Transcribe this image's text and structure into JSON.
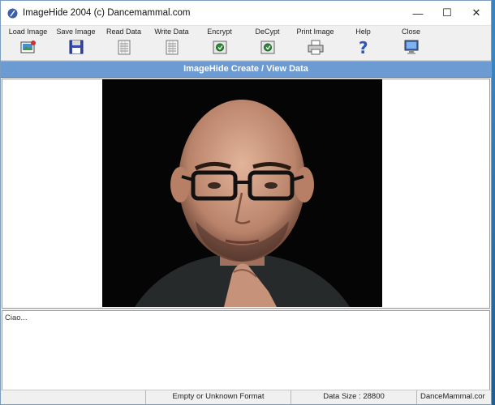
{
  "window": {
    "title": "ImageHide 2004 (c) Dancemammal.com",
    "minimize": "—",
    "maximize": "☐",
    "close": "✕"
  },
  "toolbar": [
    {
      "label": "Load Image",
      "icon": "load-image-icon"
    },
    {
      "label": "Save Image",
      "icon": "floppy-disk-icon"
    },
    {
      "label": "Read Data",
      "icon": "read-data-icon"
    },
    {
      "label": "Write Data",
      "icon": "write-data-icon"
    },
    {
      "label": "Encrypt",
      "icon": "encrypt-icon"
    },
    {
      "label": "DeCypt",
      "icon": "decrypt-icon"
    },
    {
      "label": "Print Image",
      "icon": "printer-icon"
    },
    {
      "label": "Help",
      "icon": "help-icon"
    },
    {
      "label": "Close",
      "icon": "close-monitor-icon"
    }
  ],
  "header": {
    "title": "ImageHide Create / View Data"
  },
  "editor": {
    "text": "Ciao..."
  },
  "status": {
    "cell1": "",
    "cell2": "Empty or Unknown Format",
    "cell3": "Data Size : 28800",
    "cell4": "DanceMammal.cor"
  },
  "colors": {
    "header_strip": "#6b9bd2",
    "desktop": "#2a6fa8"
  }
}
